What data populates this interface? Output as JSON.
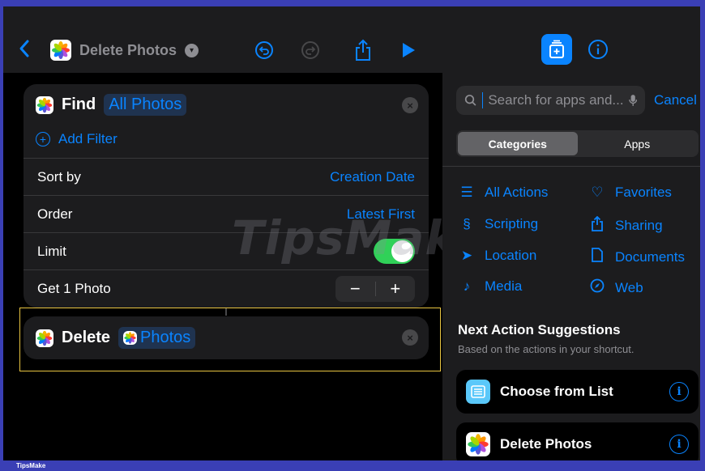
{
  "topbar": {
    "back_icon": "chevron-left-icon",
    "shortcut_title": "Delete Photos",
    "title_menu_icon": "chevron-down-icon",
    "undo_icon": "undo-icon",
    "redo_icon": "redo-icon",
    "share_icon": "share-icon",
    "run_icon": "play-icon"
  },
  "find_action": {
    "verb": "Find",
    "target": "All Photos",
    "add_filter_label": "Add Filter",
    "rows": [
      {
        "label": "Sort by",
        "value": "Creation Date"
      },
      {
        "label": "Order",
        "value": "Latest First"
      },
      {
        "label": "Limit",
        "toggle_on": true
      },
      {
        "label": "Get 1 Photo",
        "stepper_minus": "−",
        "stepper_plus": "+"
      }
    ]
  },
  "delete_action": {
    "verb": "Delete",
    "target": "Photos"
  },
  "watermark": "TipsMake",
  "right_panel": {
    "search_placeholder": "Search for apps and...",
    "cancel_label": "Cancel",
    "segments": [
      "Categories",
      "Apps"
    ],
    "selected_segment": "Categories",
    "categories": [
      {
        "label": "All Actions",
        "icon": "list-icon"
      },
      {
        "label": "Favorites",
        "icon": "heart-icon"
      },
      {
        "label": "Scripting",
        "icon": "scripting-icon"
      },
      {
        "label": "Sharing",
        "icon": "share-icon"
      },
      {
        "label": "Location",
        "icon": "location-icon"
      },
      {
        "label": "Documents",
        "icon": "document-icon"
      },
      {
        "label": "Media",
        "icon": "music-note-icon"
      },
      {
        "label": "Web",
        "icon": "compass-icon"
      }
    ],
    "suggestions_title": "Next Action Suggestions",
    "suggestions_subtitle": "Based on the actions in your shortcut.",
    "suggestions": [
      {
        "label": "Choose from List",
        "icon": "list-app-icon"
      },
      {
        "label": "Delete Photos",
        "icon": "photos-app-icon"
      }
    ]
  },
  "footer": {
    "brand": "TipsMake"
  },
  "colors": {
    "accent": "#0a84ff",
    "selection": "#e8c440",
    "toggle_on": "#30d158",
    "frame": "#3a3fb5"
  }
}
